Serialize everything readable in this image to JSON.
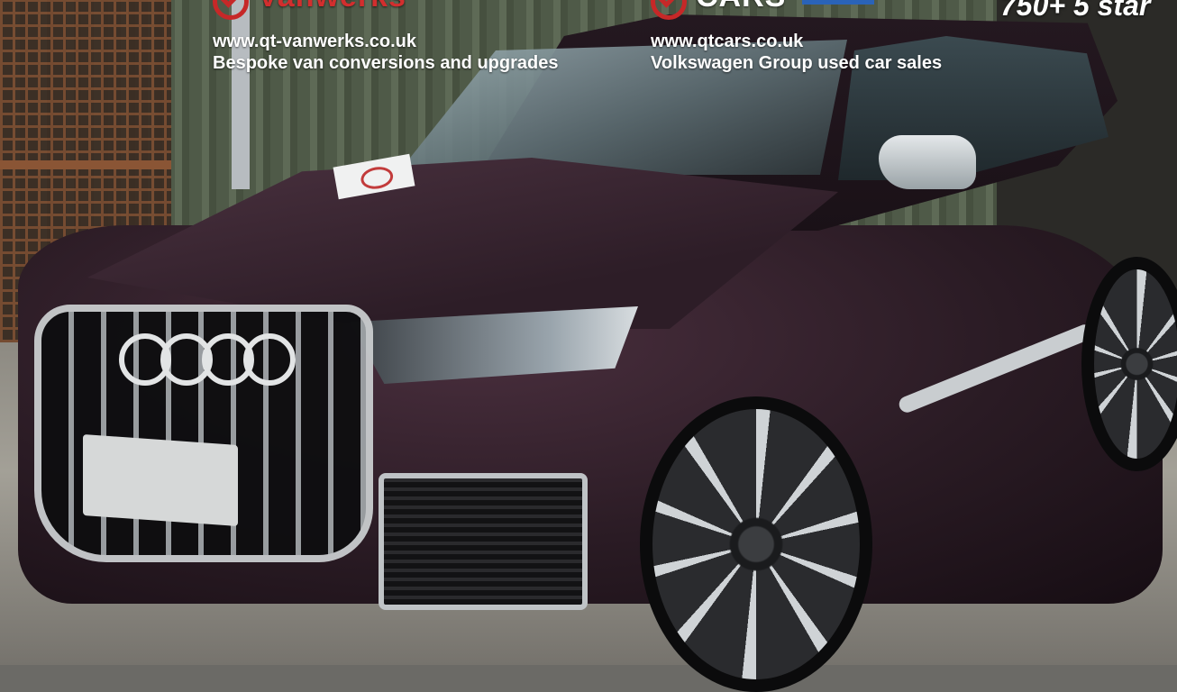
{
  "banner": {
    "vanwerks": {
      "logo_text": "Vanwerks",
      "url": "www.qt-vanwerks.co.uk",
      "tagline": "Bespoke van conversions and upgrades"
    },
    "cars": {
      "logo_text": "CARS",
      "url": "www.qtcars.co.uk",
      "tagline": "Volkswagen Group used car sales"
    },
    "rating_text": "750+ 5 star"
  },
  "colors": {
    "brand_red": "#d22e2e",
    "flag_blue": "#2a63b8",
    "car_body": "#2a1b24"
  },
  "icons": [
    "qt-logo-icon",
    "qt-logo-icon"
  ]
}
